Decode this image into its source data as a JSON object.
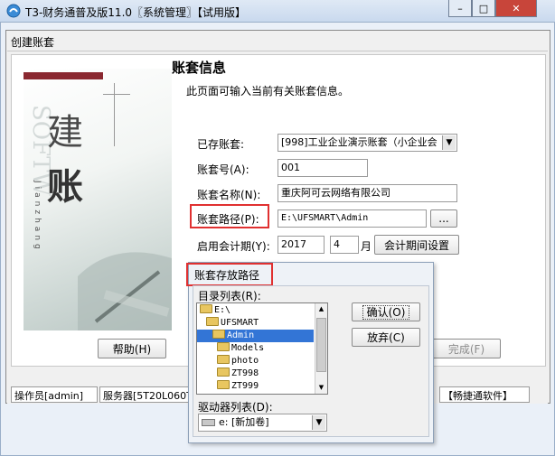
{
  "window": {
    "title": "T3-财务通普及版11.0〖系统管理〗【试用版】",
    "minimize": "–",
    "maximize": "□",
    "close": "✕"
  },
  "dialog": {
    "title": "创建账套"
  },
  "banner": {
    "char1": "建",
    "char2": "账",
    "vertical_text": "Jianzhang",
    "watermark": "SOFTW"
  },
  "heading": {
    "title": "账套信息",
    "subtitle": "此页面可输入当前有关账套信息。"
  },
  "form": {
    "existing_label": "已存账套:",
    "existing_value": "[998]工业企业演示账套（小企业会",
    "number_label": "账套号(A):",
    "number_value": "001",
    "name_label": "账套名称(N):",
    "name_value": "重庆阿可云网络有限公司",
    "path_label": "账套路径(P):",
    "path_value": "E:\\UFSMART\\Admin",
    "browse_label": "...",
    "period_label": "启用会计期(Y):",
    "year_value": "2017",
    "month_value": "4",
    "month_unit": "月",
    "period_settings_button": "会计期间设置"
  },
  "buttons": {
    "help": "帮助(H)",
    "finish": "完成(F)"
  },
  "statusbar": {
    "operator": "操作员[admin]",
    "server": "服务器[5T20L060T",
    "brand": "【畅捷通软件】"
  },
  "path_dialog": {
    "title": "账套存放路径",
    "dir_label": "目录列表(R):",
    "ok": "确认(O)",
    "cancel": "放弃(C)",
    "tree": [
      "E:\\",
      "UFSMART",
      "Admin",
      "Models",
      "photo",
      "ZT998",
      "ZT999"
    ],
    "selected_index": 2,
    "drive_label": "驱动器列表(D):",
    "drive_value": "e: [新加卷]"
  }
}
